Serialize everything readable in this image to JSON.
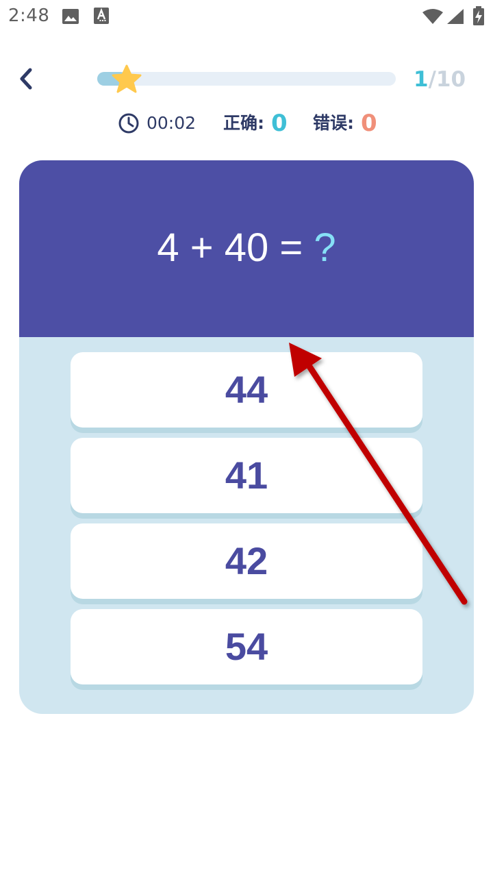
{
  "status_bar": {
    "time": "2:48",
    "icons": [
      "image-icon",
      "font-download-icon",
      "wifi-icon",
      "cellular-signal-icon",
      "battery-charging-icon"
    ]
  },
  "header": {
    "back_icon": "chevron-left-icon",
    "progress_fraction": 0.1,
    "progress_marker_icon": "star-icon",
    "counter_current": "1",
    "counter_separator": "/",
    "counter_total": "10"
  },
  "stats": {
    "timer_icon": "clock-icon",
    "timer": "00:02",
    "correct_label": "正确:",
    "correct_value": "0",
    "wrong_label": "错误:",
    "wrong_value": "0"
  },
  "question": {
    "expression": "4 + 40 = ",
    "unknown": "?"
  },
  "options": [
    {
      "label": "44"
    },
    {
      "label": "41"
    },
    {
      "label": "42"
    },
    {
      "label": "54"
    }
  ],
  "colors": {
    "primary": "#4d4fa5",
    "card_background": "#d0e6f0",
    "correct": "#3fbfd6",
    "wrong": "#f0907a",
    "star": "#ffc94d",
    "arrow": "#c00000"
  }
}
